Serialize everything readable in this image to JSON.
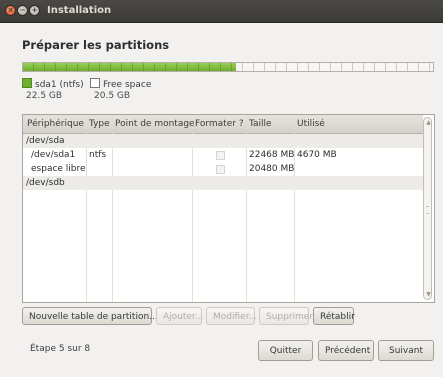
{
  "window": {
    "title": "Installation"
  },
  "heading": "Préparer les partitions",
  "partition_bar": {
    "used_fraction": 0.52,
    "fill_color": "#7dbb3e",
    "legend": [
      {
        "name": "sda1 (ntfs)",
        "size": "22.5 GB",
        "color": "#6fae31"
      },
      {
        "name": "Free space",
        "size": "20.5 GB",
        "color": "#ffffff"
      }
    ]
  },
  "table": {
    "columns": [
      "Périphérique",
      "Type",
      "Point de montage",
      "Formater ?",
      "Taille",
      "Utilisé"
    ],
    "rows": [
      {
        "device": "/dev/sda",
        "type": "",
        "mount": "",
        "format": false,
        "size": "",
        "used": "",
        "show_check": false
      },
      {
        "device": "/dev/sda1",
        "type": "ntfs",
        "mount": "",
        "format": false,
        "size": "22468 MB",
        "used": "4670 MB",
        "show_check": true
      },
      {
        "device": "espace libre",
        "type": "",
        "mount": "",
        "format": false,
        "size": "20480 MB",
        "used": "",
        "show_check": true
      },
      {
        "device": "/dev/sdb",
        "type": "",
        "mount": "",
        "format": false,
        "size": "",
        "used": "",
        "show_check": false
      }
    ]
  },
  "actions": {
    "new_table": "Nouvelle table de partition...",
    "add": "Ajouter...",
    "modify": "Modifier...",
    "delete": "Supprimer",
    "revert": "Rétablir"
  },
  "footer": {
    "step": "Étape 5 sur 8",
    "quit": "Quitter",
    "previous": "Précédent",
    "next": "Suivant"
  },
  "icons": {
    "close": "close-icon",
    "minimize": "minimize-icon",
    "maximize": "maximize-icon",
    "scroll_up": "chevron-up-icon",
    "scroll_down": "chevron-down-icon"
  }
}
